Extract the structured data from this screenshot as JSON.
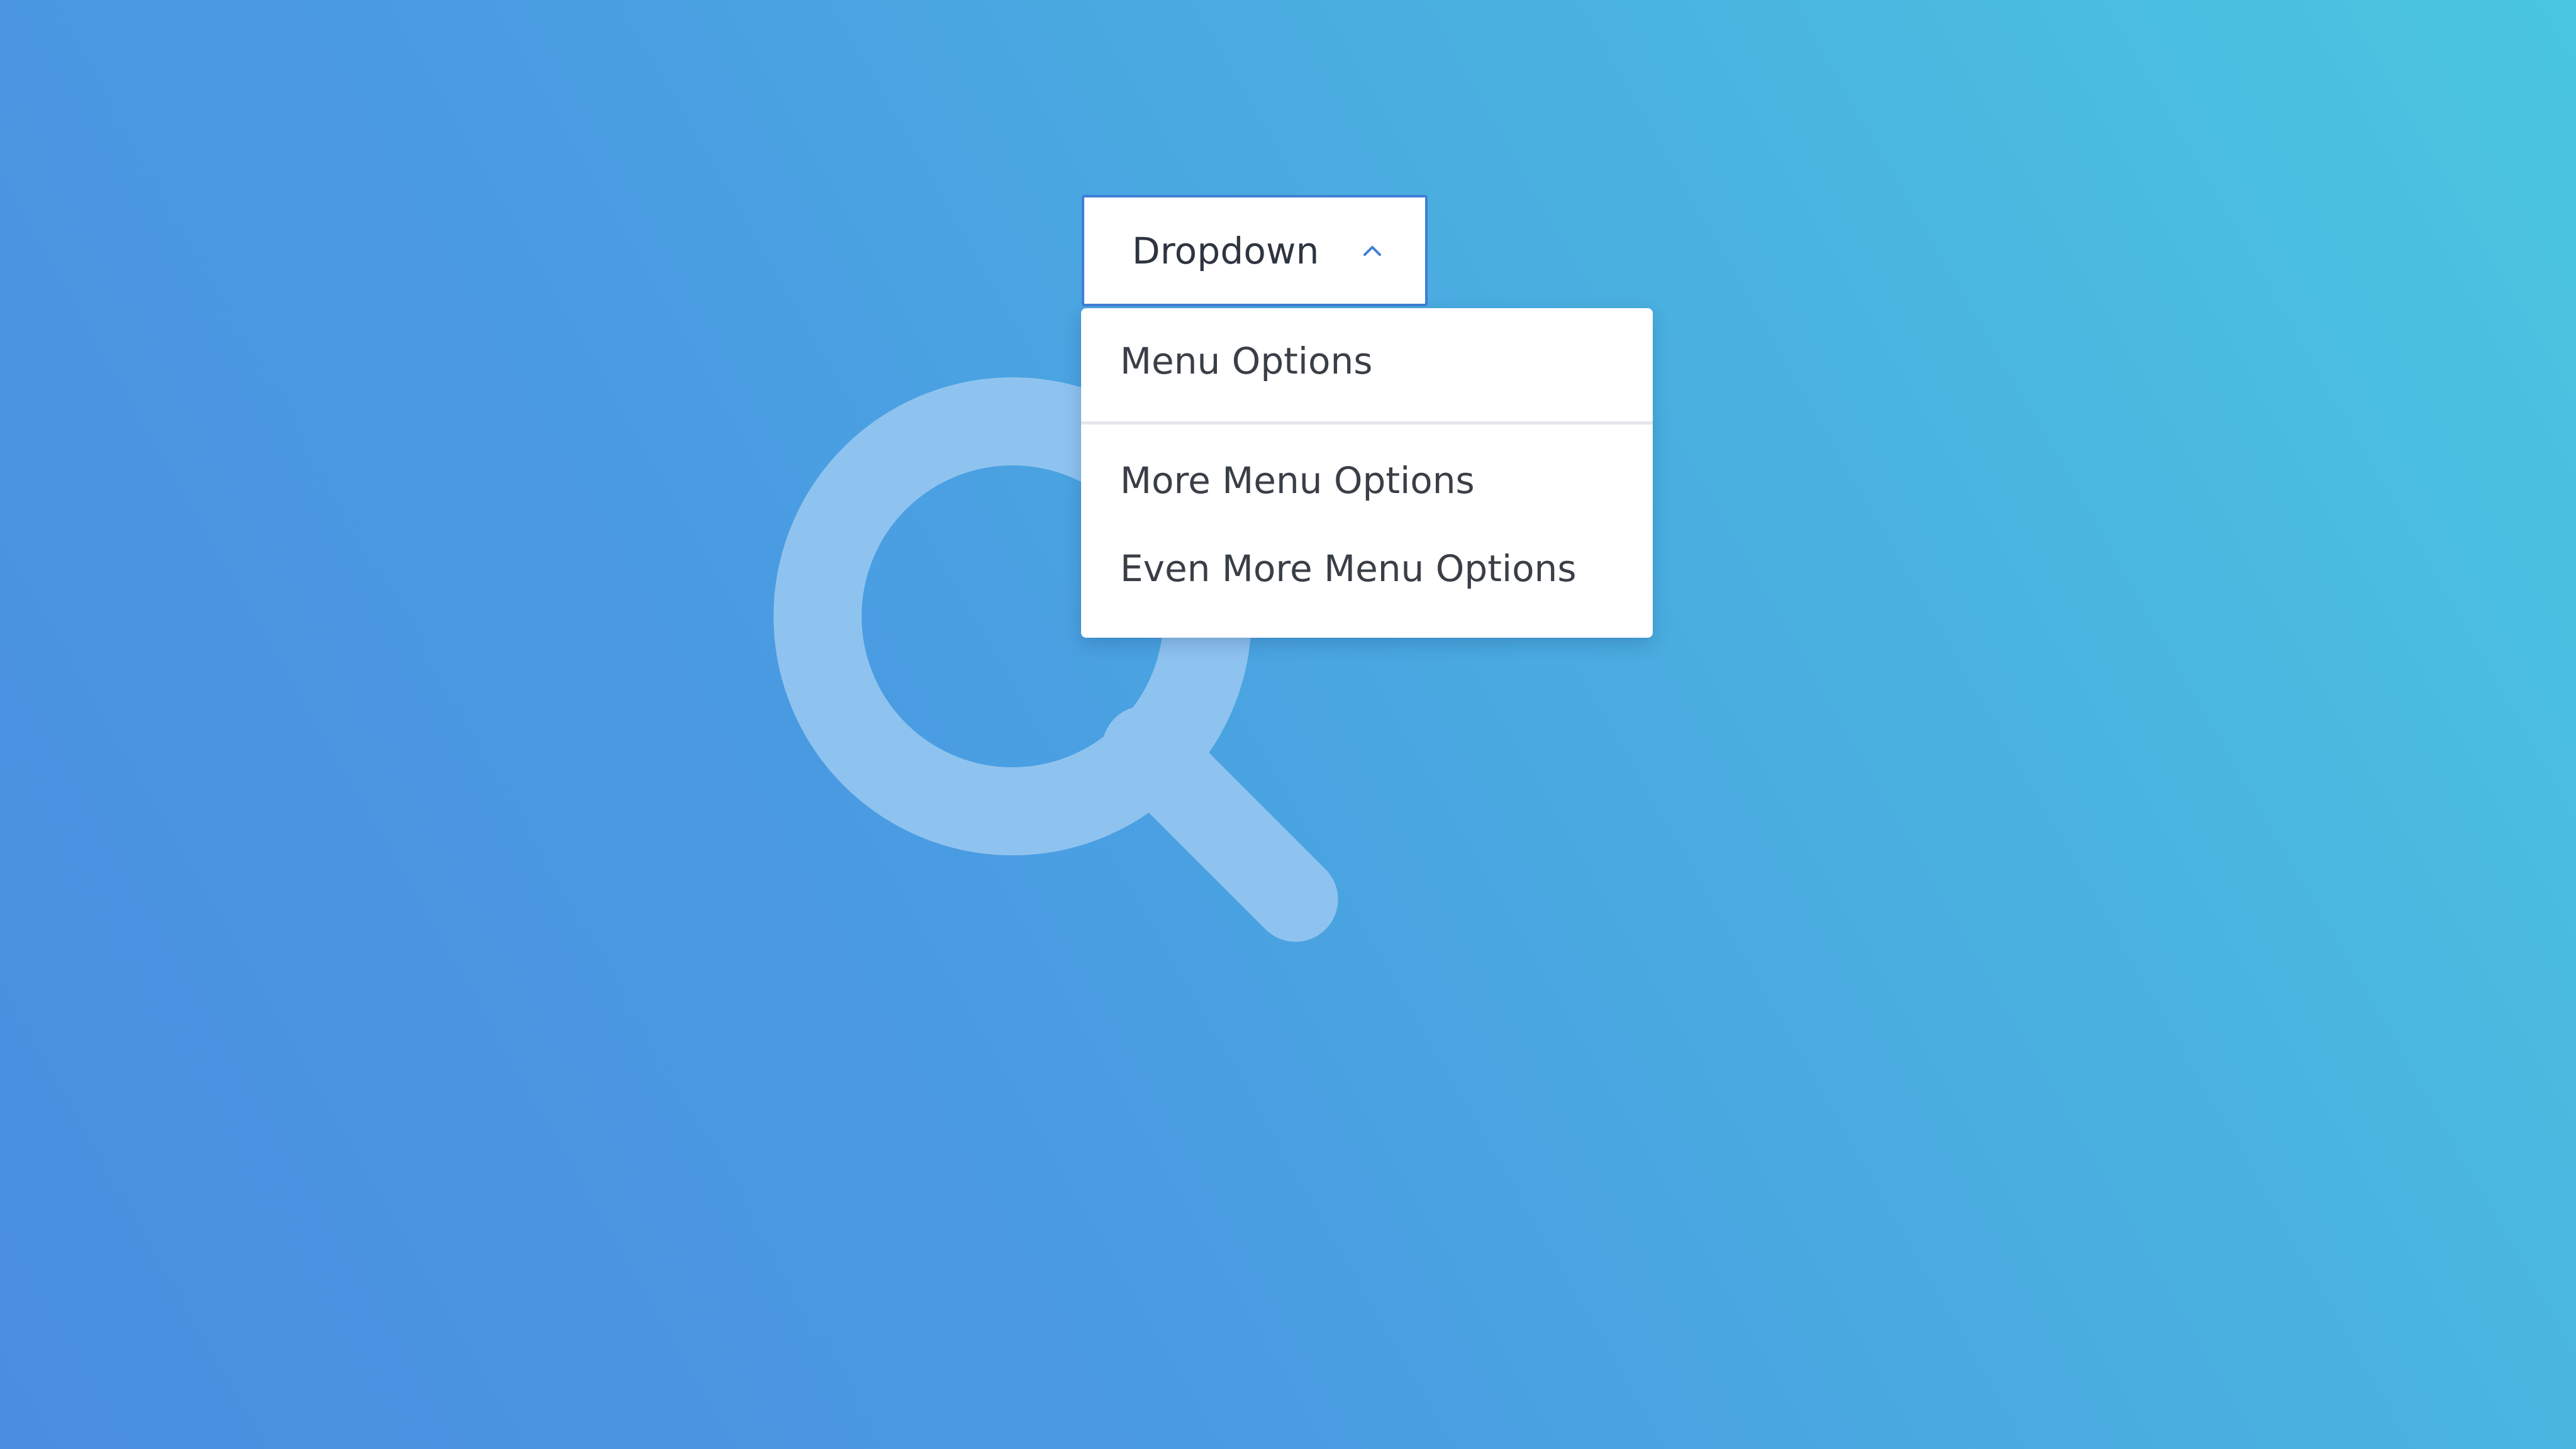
{
  "dropdown": {
    "label": "Dropdown",
    "chevron_icon": "chevron-up-icon",
    "accent_color": "#3f7fd6"
  },
  "menu": {
    "items": [
      {
        "label": "Menu Options"
      },
      {
        "label": "More Menu Options"
      },
      {
        "label": "Even More Menu Options"
      }
    ]
  },
  "background": {
    "icon": "search-icon",
    "gradient_start": "#4a8ee0",
    "gradient_end": "#4ac6e0"
  }
}
